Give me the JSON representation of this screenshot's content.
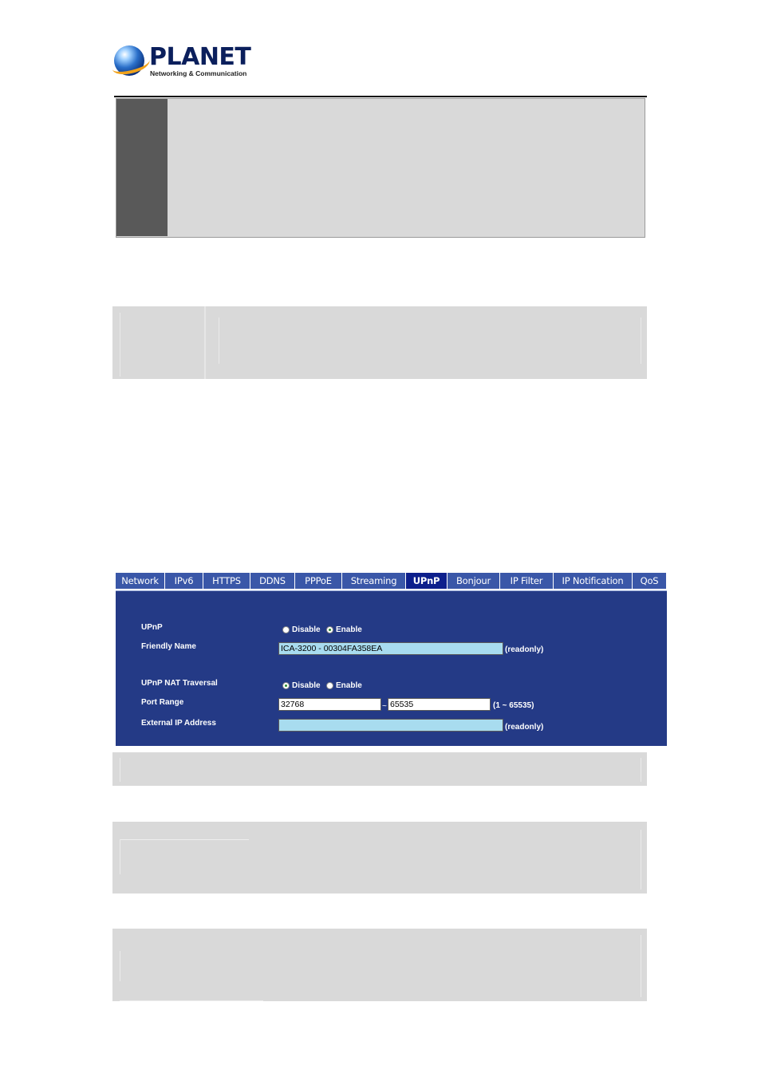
{
  "logo": {
    "name": "PLANET",
    "tagline": "Networking & Communication"
  },
  "tabs": [
    {
      "label": "Network",
      "w": 62
    },
    {
      "label": "IPv6",
      "w": 48
    },
    {
      "label": "HTTPS",
      "w": 59
    },
    {
      "label": "DDNS",
      "w": 56
    },
    {
      "label": "PPPoE",
      "w": 59
    },
    {
      "label": "Streaming",
      "w": 80
    },
    {
      "label": "UPnP",
      "w": 52,
      "active": true
    },
    {
      "label": "Bonjour",
      "w": 66
    },
    {
      "label": "IP Filter",
      "w": 67
    },
    {
      "label": "IP Notification",
      "w": 99
    },
    {
      "label": "QoS",
      "w": 43
    }
  ],
  "form": {
    "upnp": {
      "label": "UPnP",
      "options": [
        "Disable",
        "Enable"
      ],
      "selected": "Enable"
    },
    "friendly_name": {
      "label": "Friendly Name",
      "value": "ICA-3200 - 00304FA358EA",
      "note": "(readonly)"
    },
    "nat_traversal": {
      "label": "UPnP NAT Traversal",
      "options": [
        "Disable",
        "Enable"
      ],
      "selected": "Disable"
    },
    "port_range": {
      "label": "Port Range",
      "from": "32768",
      "separator": "~",
      "to": "65535",
      "note": "(1 ~ 65535)"
    },
    "external_ip": {
      "label": "External IP Address",
      "value": "",
      "note": "(readonly)"
    }
  },
  "colors": {
    "tab": "#3a57a8",
    "tab_active": "#0d1f8c",
    "panel": "#243a86",
    "readonly_field": "#a8dcef",
    "block": "#d9d9d9",
    "block_side": "#595959"
  }
}
